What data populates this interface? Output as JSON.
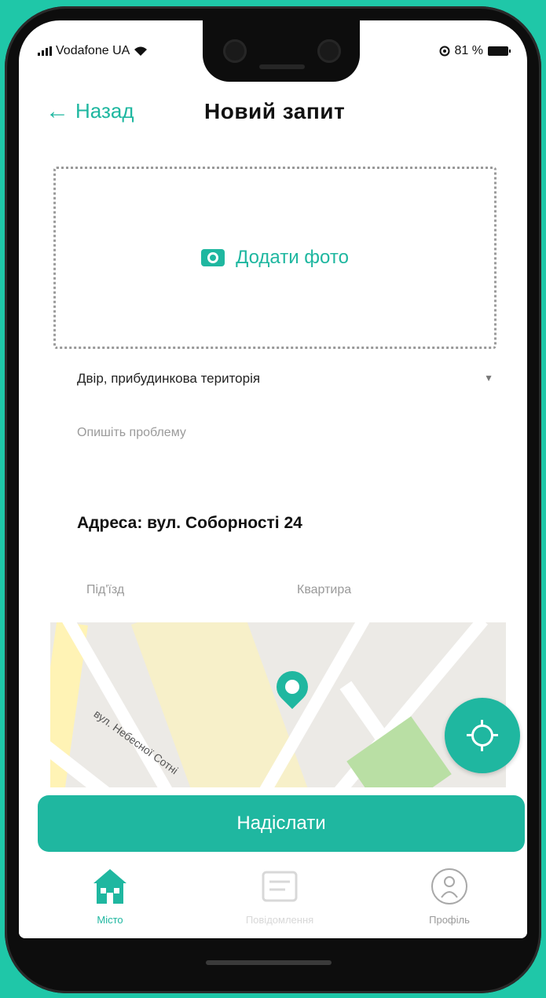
{
  "status": {
    "carrier": "Vodafone UA",
    "battery": "81 %"
  },
  "header": {
    "back_label": "Назад",
    "title": "Новий запит"
  },
  "photo": {
    "label": "Додати фото",
    "icon": "camera-icon"
  },
  "form": {
    "category": "Двір, прибудинкова територія",
    "description_placeholder": "Опишіть проблему",
    "address": "Адреса: вул. Соборності 24",
    "entrance_placeholder": "Під'їзд",
    "apartment_placeholder": "Квартира"
  },
  "map": {
    "street_label": "вул. Небесної Сотні"
  },
  "actions": {
    "send_label": "Надіслати"
  },
  "tabs": [
    {
      "label": "Місто",
      "icon": "home-icon",
      "active": true
    },
    {
      "label": "Повідомлення",
      "icon": "message-icon",
      "active": false
    },
    {
      "label": "Профіль",
      "icon": "profile-icon",
      "active": false
    }
  ],
  "colors": {
    "accent": "#1fb7a0",
    "background": "#1fc7a8"
  }
}
